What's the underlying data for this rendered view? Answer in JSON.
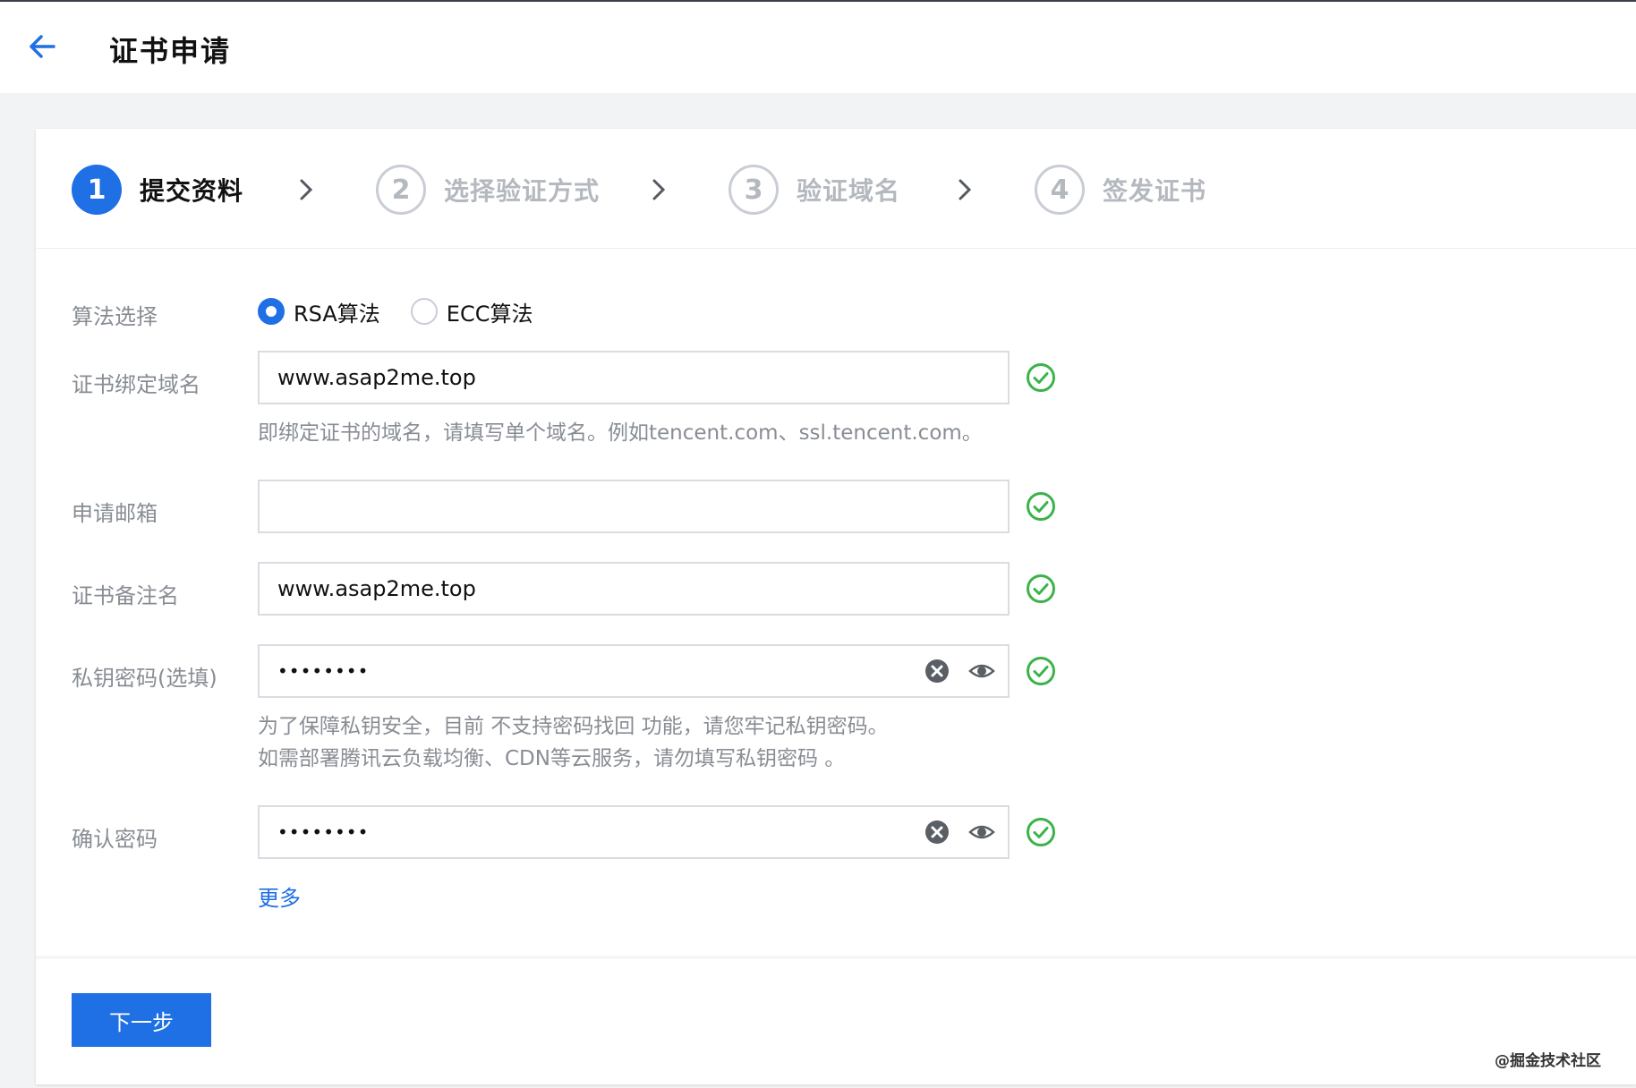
{
  "header": {
    "title": "证书申请",
    "back_icon": "arrow-left-icon"
  },
  "steps": [
    {
      "number": "1",
      "label": "提交资料",
      "state": "active"
    },
    {
      "number": "2",
      "label": "选择验证方式",
      "state": "inactive"
    },
    {
      "number": "3",
      "label": "验证域名",
      "state": "inactive"
    },
    {
      "number": "4",
      "label": "签发证书",
      "state": "inactive"
    }
  ],
  "form": {
    "algorithm": {
      "label": "算法选择",
      "options": [
        {
          "label": "RSA算法",
          "checked": true
        },
        {
          "label": "ECC算法",
          "checked": false
        }
      ]
    },
    "domain": {
      "label": "证书绑定域名",
      "value": "www.asap2me.top",
      "hint": "即绑定证书的域名，请填写单个域名。例如tencent.com、ssl.tencent.com。"
    },
    "email": {
      "label": "申请邮箱",
      "value": ""
    },
    "remark": {
      "label": "证书备注名",
      "value": "www.asap2me.top"
    },
    "private_key_password": {
      "label": "私钥密码(选填)",
      "value": "••••••••",
      "hint_lines": [
        "为了保障私钥安全，目前 不支持密码找回 功能，请您牢记私钥密码。",
        "如需部署腾讯云负载均衡、CDN等云服务，请勿填写私钥密码 。"
      ]
    },
    "confirm_password": {
      "label": "确认密码",
      "value": "••••••••"
    },
    "more_link": "更多"
  },
  "actions": {
    "next_label": "下一步"
  },
  "watermark": "@掘金技术社区",
  "colors": {
    "primary": "#1f6fe5",
    "success": "#3bb34a",
    "muted_text": "#888d94",
    "inactive_step": "#b4b8bf",
    "border": "#d9dce1"
  }
}
